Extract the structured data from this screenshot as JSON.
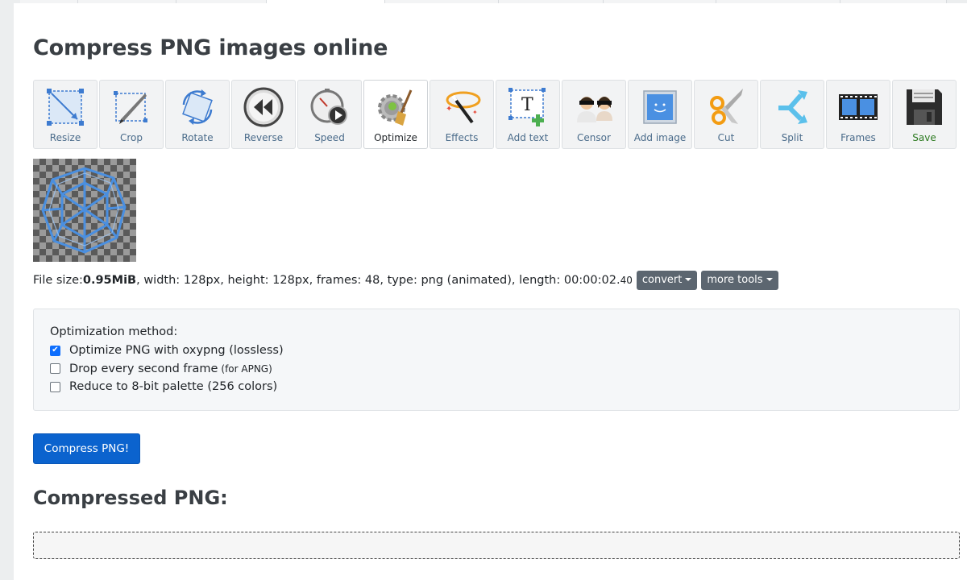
{
  "page": {
    "title": "Compress PNG images online"
  },
  "toolbar": [
    {
      "label": "Resize",
      "icon": "resize-icon"
    },
    {
      "label": "Crop",
      "icon": "crop-icon"
    },
    {
      "label": "Rotate",
      "icon": "rotate-icon"
    },
    {
      "label": "Reverse",
      "icon": "reverse-icon"
    },
    {
      "label": "Speed",
      "icon": "speed-icon"
    },
    {
      "label": "Optimize",
      "icon": "optimize-icon",
      "active": true
    },
    {
      "label": "Effects",
      "icon": "effects-icon"
    },
    {
      "label": "Add text",
      "icon": "add-text-icon"
    },
    {
      "label": "Censor",
      "icon": "censor-icon"
    },
    {
      "label": "Add image",
      "icon": "add-image-icon"
    },
    {
      "label": "Cut",
      "icon": "cut-icon"
    },
    {
      "label": "Split",
      "icon": "split-icon"
    },
    {
      "label": "Frames",
      "icon": "frames-icon"
    },
    {
      "label": "Save",
      "icon": "save-icon"
    }
  ],
  "fileinfo": {
    "size_label": "File size: ",
    "size_value": "0.95MiB",
    "details": ", width: 128px, height: 128px, frames: 48, type: png (animated), length: 00:00:02.",
    "length_small": "40",
    "convert_label": "convert",
    "more_tools_label": "more tools"
  },
  "options": {
    "heading": "Optimization method:",
    "items": [
      {
        "label": "Optimize PNG with oxypng (lossless)",
        "small": "",
        "checked": true
      },
      {
        "label": "Drop every second frame",
        "small": "(for APNG)",
        "checked": false
      },
      {
        "label": "Reduce to 8-bit palette (256 colors)",
        "small": "",
        "checked": false
      }
    ]
  },
  "compress_button": "Compress PNG!",
  "result": {
    "title": "Compressed PNG:"
  },
  "colors": {
    "primary": "#0b63ce",
    "toolbar_bg": "#f2f3f4",
    "dropdown_bg": "#5c6670"
  }
}
